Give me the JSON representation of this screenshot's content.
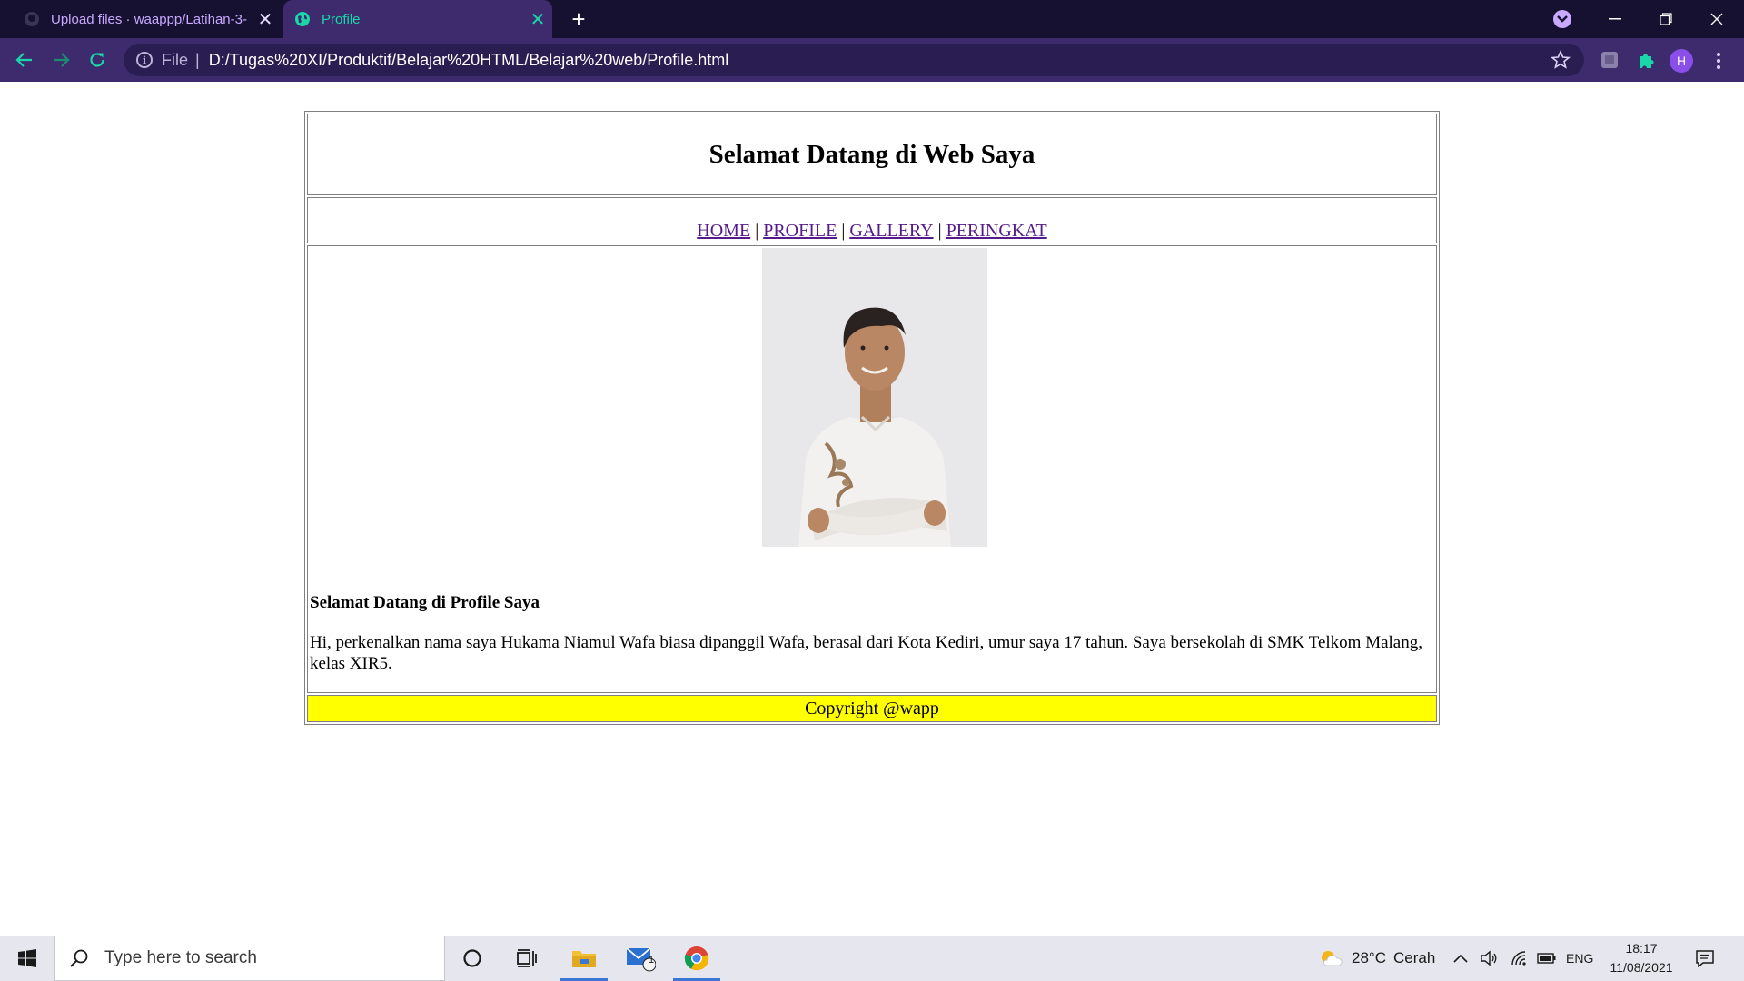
{
  "browser": {
    "tabs": [
      {
        "title": "Upload files · waappp/Latihan-3-",
        "active": false,
        "icon": "github-icon"
      },
      {
        "title": "Profile",
        "active": true,
        "icon": "globe-icon"
      }
    ],
    "address": {
      "scheme": "File",
      "separator": "|",
      "url": "D:/Tugas%20XI/Produktif/Belajar%20HTML/Belajar%20web/Profile.html"
    },
    "profile_initial": "H",
    "colors": {
      "frame": "#161130",
      "toolbar": "#3d2b6e",
      "accent": "#19d7a8"
    }
  },
  "page": {
    "header_title": "Selamat Datang di Web Saya",
    "nav": [
      {
        "label": "HOME"
      },
      {
        "label": "PROFILE"
      },
      {
        "label": "GALLERY"
      },
      {
        "label": "PERINGKAT"
      }
    ],
    "nav_separator": "|",
    "profile_title": "Selamat Datang di Profile Saya",
    "profile_text": "Hi, perkenalkan nama saya Hukama Niamul Wafa biasa dipanggil Wafa, berasal dari Kota Kediri, umur saya 17 tahun. Saya bersekolah di SMK Telkom Malang, kelas XIR5.",
    "footer": "Copyright @wapp",
    "footer_color": "#ffff00"
  },
  "taskbar": {
    "search_placeholder": "Type here to search",
    "mail_badge": "1",
    "weather": {
      "temp": "28°C",
      "condition": "Cerah"
    },
    "language": "ENG",
    "time": "18:17",
    "date": "11/08/2021"
  }
}
